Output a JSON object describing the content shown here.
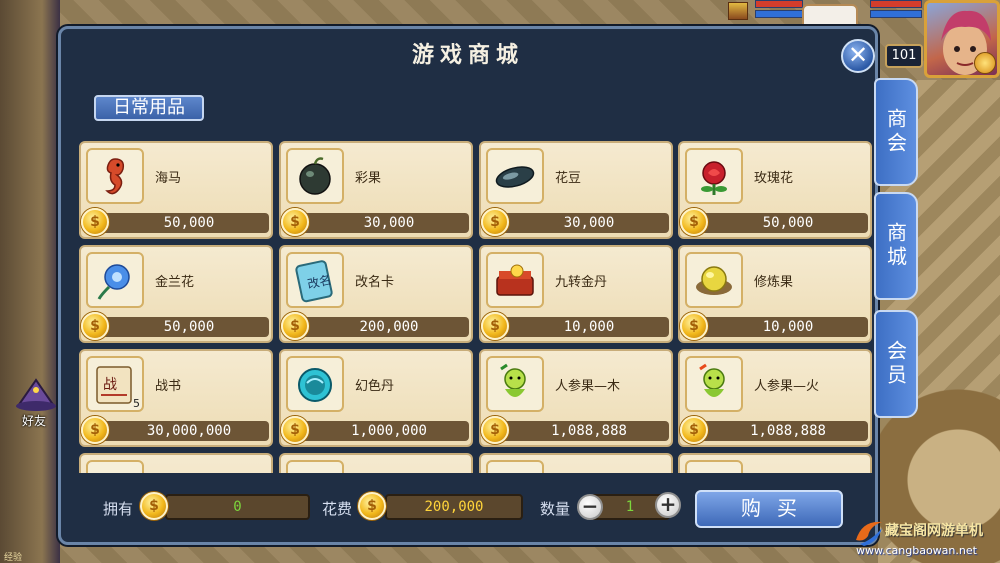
{
  "shop": {
    "title": "游戏商城",
    "category_tab": "日常用品",
    "close_symbol": "✕"
  },
  "side_tabs": [
    "商会",
    "商城",
    "会员"
  ],
  "items": [
    {
      "name": "海马",
      "price": "50,000",
      "icon": "seahorse-icon"
    },
    {
      "name": "彩果",
      "price": "30,000",
      "icon": "color-fruit-icon"
    },
    {
      "name": "花豆",
      "price": "30,000",
      "icon": "flower-bean-icon"
    },
    {
      "name": "玫瑰花",
      "price": "50,000",
      "icon": "rose-icon"
    },
    {
      "name": "金兰花",
      "price": "50,000",
      "icon": "orchid-icon"
    },
    {
      "name": "改名卡",
      "price": "200,000",
      "icon": "rename-card-icon"
    },
    {
      "name": "九转金丹",
      "price": "10,000",
      "icon": "golden-pill-box-icon"
    },
    {
      "name": "修炼果",
      "price": "10,000",
      "icon": "training-fruit-icon"
    },
    {
      "name": "战书",
      "price": "30,000,000",
      "icon": "war-letter-icon",
      "count": "5"
    },
    {
      "name": "幻色丹",
      "price": "1,000,000",
      "icon": "illusion-pill-icon"
    },
    {
      "name": "人参果—木",
      "price": "1,088,888",
      "icon": "ginseng-fruit-wood-icon"
    },
    {
      "name": "人参果—火",
      "price": "1,088,888",
      "icon": "ginseng-fruit-fire-icon"
    },
    {
      "name": "",
      "price": "",
      "icon": "partial-item-icon"
    },
    {
      "name": "",
      "price": "",
      "icon": "partial-item-icon"
    },
    {
      "name": "",
      "price": "",
      "icon": "partial-item-icon"
    },
    {
      "name": "",
      "price": "",
      "icon": "partial-item-icon"
    }
  ],
  "bottom": {
    "owned_label": "拥有",
    "owned_value": "0",
    "cost_label": "花费",
    "cost_value": "200,000",
    "quantity_label": "数量",
    "quantity_value": "1",
    "minus": "−",
    "plus": "+",
    "buy_label": "购买"
  },
  "hud": {
    "level": "101",
    "friend_label": "好友",
    "exp_label": "经验"
  },
  "watermark": {
    "name": "藏宝阁网游单机",
    "url": "www.cangbaowan.net"
  },
  "colors": {
    "panel_bg": "#1f2e44",
    "card_bg": "#f5ead0",
    "price_bar": "#6d5536",
    "owned_value": "#7cd63c",
    "cost_value": "#ffd43a",
    "quantity_value": "#7cd63c",
    "tab_blue": "#3d6fc4"
  }
}
